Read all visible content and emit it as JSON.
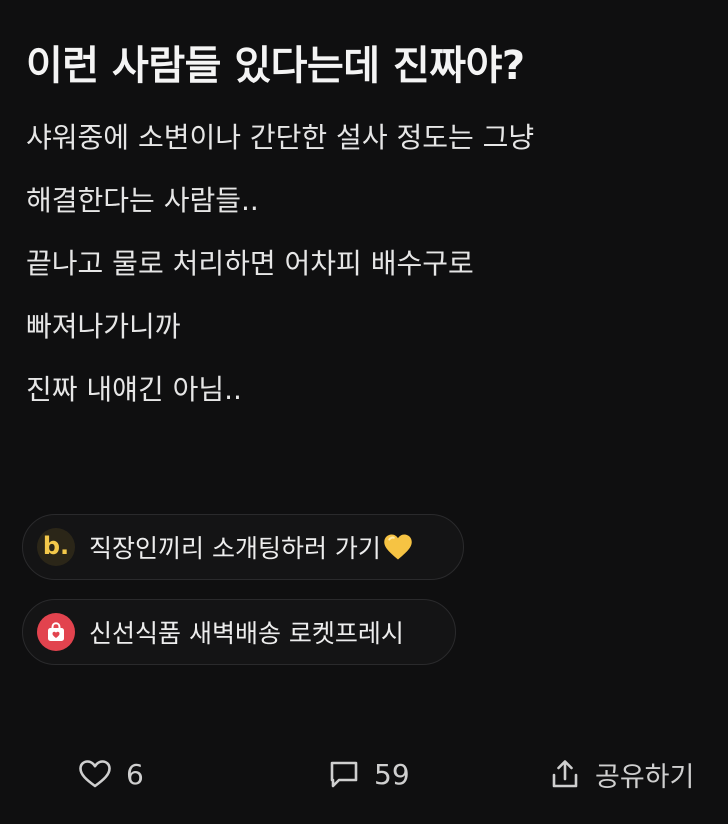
{
  "post": {
    "title": "이런 사람들 있다는데 진짜야?",
    "body_lines": [
      "샤워중에 소변이나 간단한 설사 정도는 그냥",
      "해결한다는 사람들..",
      "끝나고 물로 처리하면 어차피 배수구로",
      "빠져나가니까",
      "진짜 내얘긴 아님.."
    ]
  },
  "promos": [
    {
      "logo_icon": "b-logo-icon",
      "logo_text": "b.",
      "text": "직장인끼리 소개팅하러 가기",
      "emoji": "yellow-heart-icon"
    },
    {
      "logo_icon": "shopping-bag-icon",
      "text": "신선식품 새벽배송 로켓프레시"
    }
  ],
  "actions": {
    "like": {
      "icon": "heart-icon",
      "count": "6"
    },
    "comment": {
      "icon": "comment-icon",
      "count": "59"
    },
    "share": {
      "icon": "share-icon",
      "label": "공유하기"
    }
  },
  "colors": {
    "background": "#0f0f10",
    "text": "#f2f2f2",
    "promo_border": "#2a2a2c",
    "logo_b_bg": "#2b2618",
    "logo_b_fg": "#f3c84a",
    "bag_logo_bg": "#e2434e",
    "heart_emoji": "#f6c343"
  }
}
